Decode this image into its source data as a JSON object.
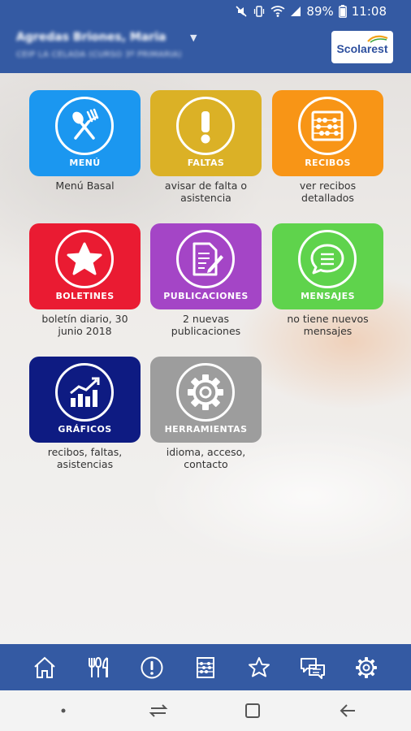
{
  "status_bar": {
    "battery": "89%",
    "time": "11:08"
  },
  "header": {
    "user_name": "Agredas Briones, Maria",
    "school": "CEIP LA CELADA (CURSO 3º PRIMARIA)",
    "logo_text": "Scolarest"
  },
  "tiles": [
    {
      "label": "MENÚ",
      "subtitle": "Menú Basal",
      "color": "#1b97f0",
      "icon": "fork-spoon-icon"
    },
    {
      "label": "FALTAS",
      "subtitle": "avisar de falta o asistencia",
      "color": "#dbb126",
      "icon": "exclamation-icon"
    },
    {
      "label": "RECIBOS",
      "subtitle": "ver recibos detallados",
      "color": "#f89516",
      "icon": "abacus-icon"
    },
    {
      "label": "BOLETINES",
      "subtitle": "boletín diario, 30 junio 2018",
      "color": "#ea1b32",
      "icon": "star-icon"
    },
    {
      "label": "PUBLICACIONES",
      "subtitle": "2 nuevas publicaciones",
      "color": "#a445c6",
      "icon": "document-pen-icon"
    },
    {
      "label": "MENSAJES",
      "subtitle": "no tiene nuevos mensajes",
      "color": "#5fd34c",
      "icon": "chat-bubble-icon"
    },
    {
      "label": "GRÁFICOS",
      "subtitle": "recibos, faltas, asistencias",
      "color": "#0e1b82",
      "icon": "bar-chart-icon"
    },
    {
      "label": "HERRAMIENTAS",
      "subtitle": "idioma, acceso, contacto",
      "color": "#9d9d9d",
      "icon": "gear-icon"
    }
  ],
  "bottom_nav": [
    "home-icon",
    "cutlery-icon",
    "alert-icon",
    "abacus-icon",
    "star-icon",
    "messages-icon",
    "settings-icon"
  ],
  "colors": {
    "header": "#345aa3",
    "nav_icon": "#ffffff"
  }
}
